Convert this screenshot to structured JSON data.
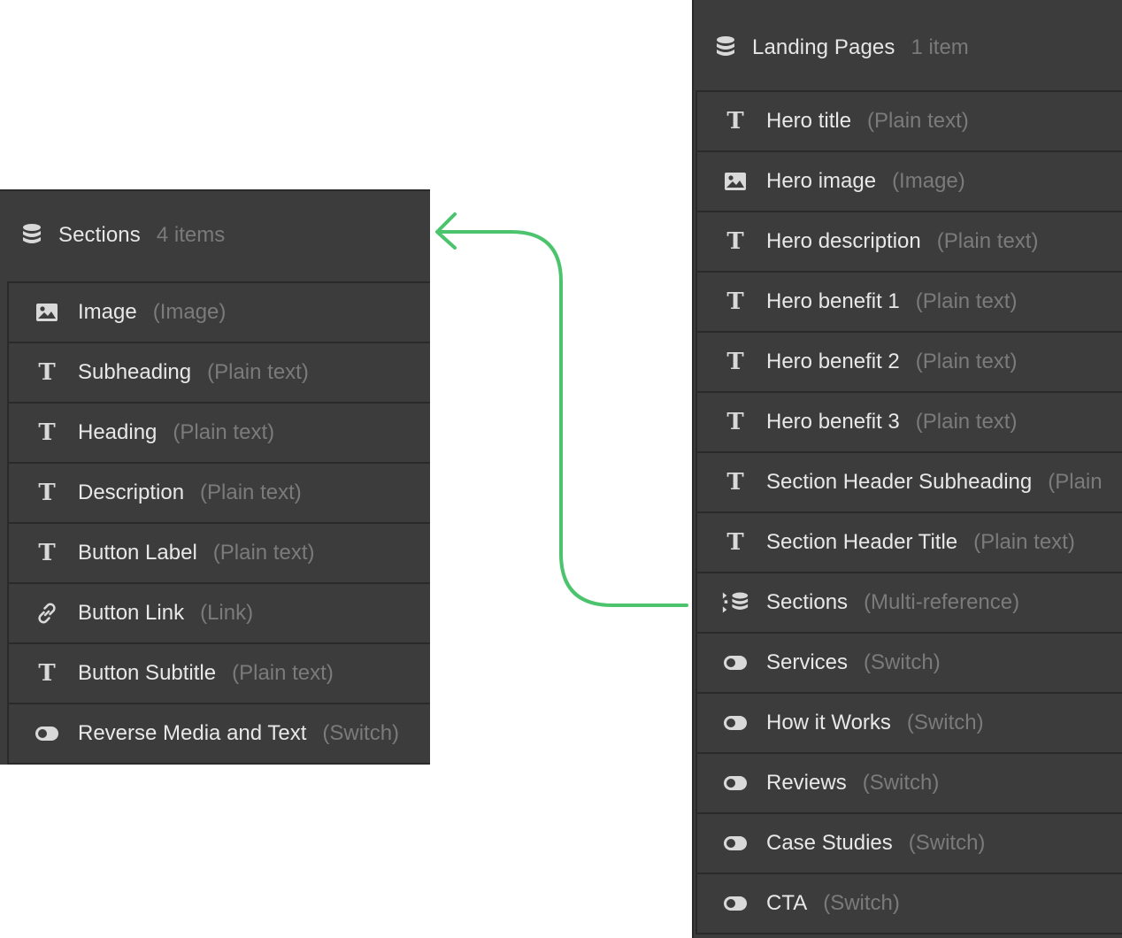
{
  "sections_panel": {
    "title": "Sections",
    "count": "4 items",
    "fields": [
      {
        "name": "Image",
        "type": "(Image)",
        "icon": "image-icon"
      },
      {
        "name": "Subheading",
        "type": "(Plain text)",
        "icon": "text-icon"
      },
      {
        "name": "Heading",
        "type": "(Plain text)",
        "icon": "text-icon"
      },
      {
        "name": "Description",
        "type": "(Plain text)",
        "icon": "text-icon"
      },
      {
        "name": "Button Label",
        "type": "(Plain text)",
        "icon": "text-icon"
      },
      {
        "name": "Button Link",
        "type": "(Link)",
        "icon": "link-icon"
      },
      {
        "name": "Button Subtitle",
        "type": "(Plain text)",
        "icon": "text-icon"
      },
      {
        "name": "Reverse Media and Text",
        "type": "(Switch)",
        "icon": "switch-icon"
      }
    ]
  },
  "landing_panel": {
    "title": "Landing Pages",
    "count": "1 item",
    "fields": [
      {
        "name": "Hero title",
        "type": "(Plain text)",
        "icon": "text-icon"
      },
      {
        "name": "Hero image",
        "type": "(Image)",
        "icon": "image-icon"
      },
      {
        "name": "Hero description",
        "type": "(Plain text)",
        "icon": "text-icon"
      },
      {
        "name": "Hero benefit 1",
        "type": "(Plain text)",
        "icon": "text-icon"
      },
      {
        "name": "Hero benefit 2",
        "type": "(Plain text)",
        "icon": "text-icon"
      },
      {
        "name": "Hero benefit 3",
        "type": "(Plain text)",
        "icon": "text-icon"
      },
      {
        "name": "Section Header Subheading",
        "type": "(Plain",
        "icon": "text-icon"
      },
      {
        "name": "Section Header Title",
        "type": "(Plain text)",
        "icon": "text-icon"
      },
      {
        "name": "Sections",
        "type": "(Multi-reference)",
        "icon": "multi-reference-icon"
      },
      {
        "name": "Services",
        "type": "(Switch)",
        "icon": "switch-icon"
      },
      {
        "name": "How it Works",
        "type": "(Switch)",
        "icon": "switch-icon"
      },
      {
        "name": "Reviews",
        "type": "(Switch)",
        "icon": "switch-icon"
      },
      {
        "name": "Case Studies",
        "type": "(Switch)",
        "icon": "switch-icon"
      },
      {
        "name": "CTA",
        "type": "(Switch)",
        "icon": "switch-icon"
      }
    ]
  },
  "colors": {
    "panel_bg": "#3c3c3c",
    "divider": "#2a2a2a",
    "text_primary": "#e8e8e8",
    "text_muted": "#7b7b7b",
    "connector": "#4cc46e"
  }
}
